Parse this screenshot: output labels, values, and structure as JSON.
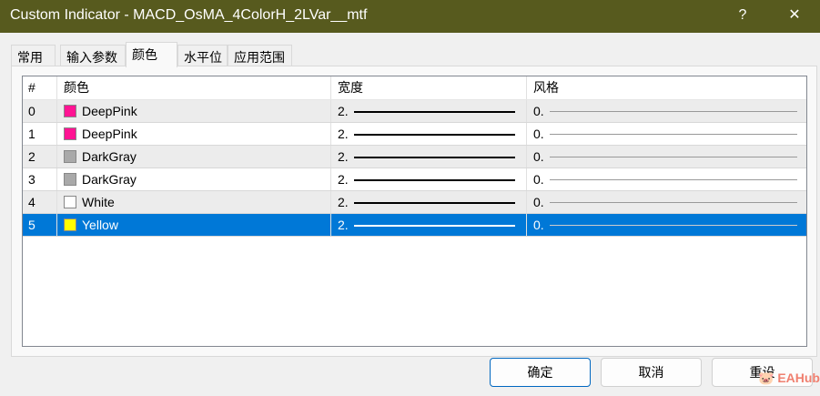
{
  "window": {
    "title": "Custom Indicator - MACD_OsMA_4ColorH_2LVar__mtf",
    "help": "?",
    "close": "✕"
  },
  "tabs": [
    "常用",
    "输入参数",
    "颜色",
    "水平位",
    "应用范围"
  ],
  "table": {
    "headers": [
      "#",
      "颜色",
      "宽度",
      "风格"
    ],
    "rows": [
      {
        "index": "0",
        "color": "DeepPink",
        "hex": "#ff1493",
        "width": "2.",
        "style": "0."
      },
      {
        "index": "1",
        "color": "DeepPink",
        "hex": "#ff1493",
        "width": "2.",
        "style": "0."
      },
      {
        "index": "2",
        "color": "DarkGray",
        "hex": "#a9a9a9",
        "width": "2.",
        "style": "0."
      },
      {
        "index": "3",
        "color": "DarkGray",
        "hex": "#a9a9a9",
        "width": "2.",
        "style": "0."
      },
      {
        "index": "4",
        "color": "White",
        "hex": "#ffffff",
        "width": "2.",
        "style": "0."
      },
      {
        "index": "5",
        "color": "Yellow",
        "hex": "#ffff00",
        "width": "2.",
        "style": "0."
      }
    ]
  },
  "buttons": {
    "ok": "确定",
    "cancel": "取消",
    "reset": "重设"
  },
  "watermark": "EAHub"
}
